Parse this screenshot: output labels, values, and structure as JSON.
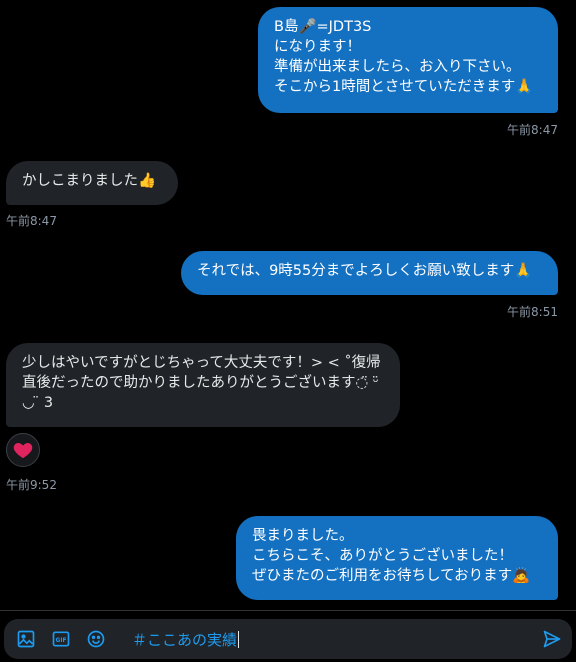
{
  "messages": [
    {
      "id": "m1",
      "text": "B島🎤=JDT3S\nになります！\n準備が出来ましたら、お入り下さい。\nそこから1時間とさせていただきます🙏",
      "time": "午前8:47"
    },
    {
      "id": "m2",
      "text": "かしこまりました👍",
      "time": "午前8:47"
    },
    {
      "id": "m3",
      "text": "それでは、9時55分までよろしくお願い致します🙏",
      "time": "午前8:51"
    },
    {
      "id": "m4",
      "text": "少しはやいですがとじちゃって大丈夫です！> < ˚復帰直後だったので助かりましたありがとうございます◌̈ ᵕ̈ ◡ ̈ 3",
      "time": "午前9:52"
    },
    {
      "id": "m5",
      "text": "畏まりました。\nこちらこそ、ありがとうございました！\nぜひまたのご利用をお待ちしております🙇"
    }
  ],
  "reaction": {
    "emoji": "heart-emoji",
    "color": "#e0245e"
  },
  "composer": {
    "text": "＃ここあの実績",
    "icons": [
      "image-icon",
      "gif-icon",
      "emoji-icon",
      "send-icon"
    ]
  },
  "colors": {
    "outgoing": "#1471c2",
    "incoming": "#202327",
    "accent": "#1d9bf0",
    "background": "#000000"
  }
}
